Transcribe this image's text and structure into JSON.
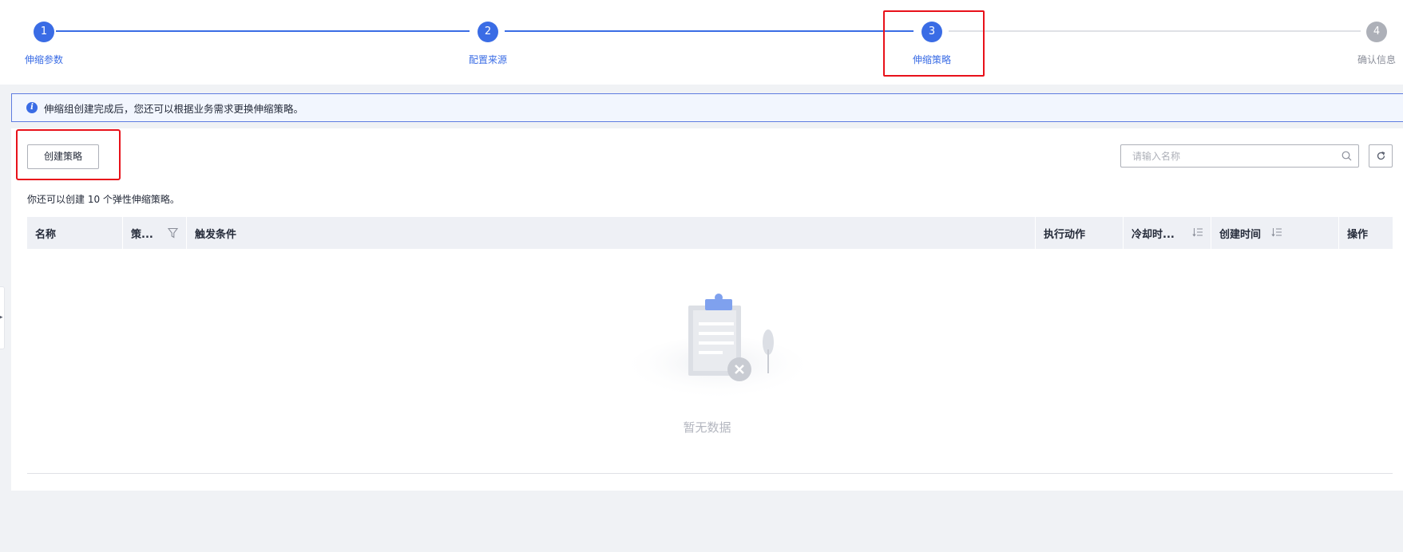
{
  "stepper": {
    "steps": [
      {
        "number": "1",
        "label": "伸缩参数",
        "status": "done"
      },
      {
        "number": "2",
        "label": "配置来源",
        "status": "done"
      },
      {
        "number": "3",
        "label": "伸缩策略",
        "status": "current"
      },
      {
        "number": "4",
        "label": "确认信息",
        "status": "todo"
      }
    ]
  },
  "info": {
    "icon": "info-icon",
    "text": "伸缩组创建完成后，您还可以根据业务需求更换伸缩策略。"
  },
  "toolbar": {
    "create_label": "创建策略",
    "search_placeholder": "请输入名称"
  },
  "quota": {
    "text": "你还可以创建 10 个弹性伸缩策略。"
  },
  "table": {
    "columns": [
      {
        "label": "名称"
      },
      {
        "label": "策...",
        "icon": "filter-icon"
      },
      {
        "label": "触发条件"
      },
      {
        "label": "执行动作"
      },
      {
        "label": "冷却时...",
        "icon": "sort-icon"
      },
      {
        "label": "创建时间",
        "icon": "sort-icon"
      },
      {
        "label": "操作"
      }
    ],
    "rows": [],
    "empty_text": "暂无数据"
  },
  "colors": {
    "primary": "#3a6ce5",
    "todo": "#adb0b8",
    "highlight": "#e8111a"
  }
}
